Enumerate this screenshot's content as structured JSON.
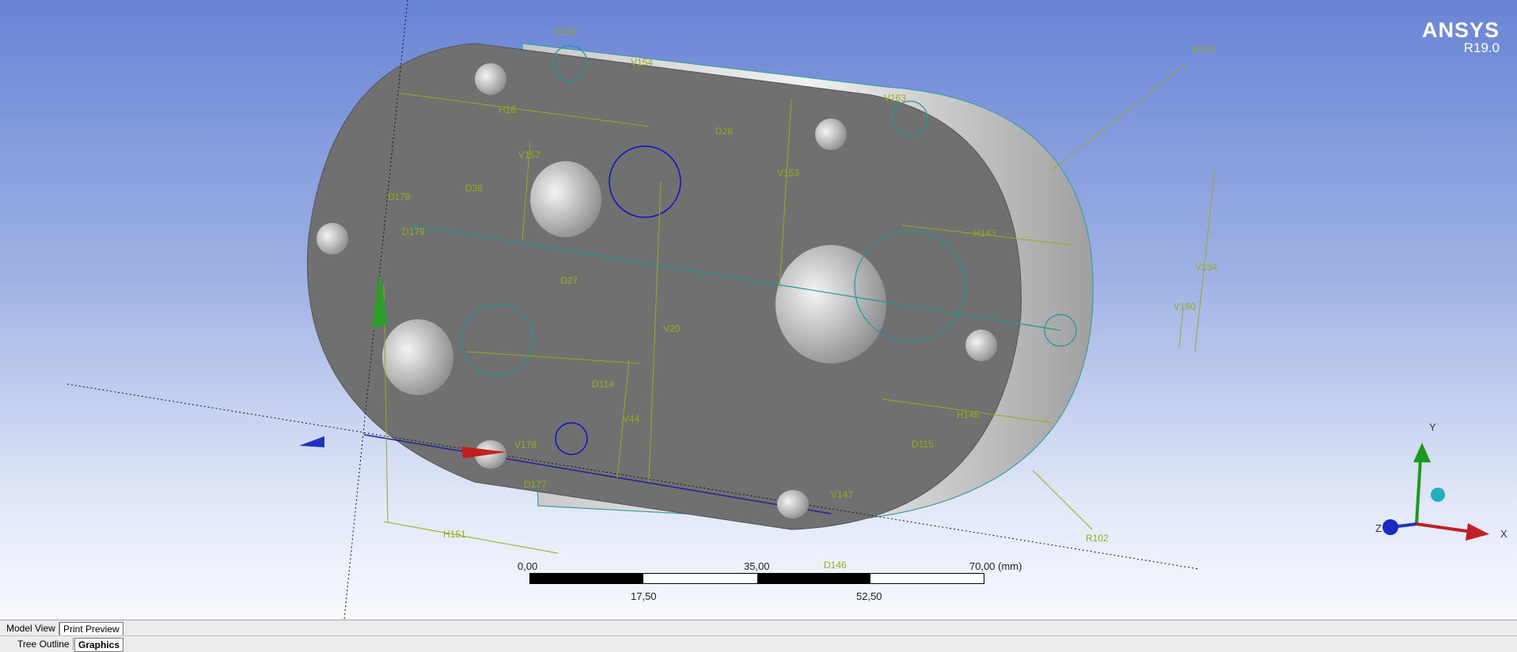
{
  "brand": {
    "name": "ANSYS",
    "version": "R19.0"
  },
  "dimensions": [
    "D152",
    "V154",
    "V163",
    "R101",
    "H16",
    "D26",
    "V157",
    "V153",
    "D178",
    "D36",
    "D179",
    "H143",
    "V134",
    "D27",
    "V160",
    "V20",
    "D114",
    "V44",
    "H145",
    "V178",
    "D115",
    "D177",
    "V147",
    "H151",
    "D146",
    "R102"
  ],
  "scale": {
    "labels_top": [
      "0,00",
      "35,00",
      "70,00 (mm)"
    ],
    "labels_bottom": [
      "17,50",
      "52,50"
    ]
  },
  "triad": {
    "x": "X",
    "y": "Y",
    "z": "Z"
  },
  "tabs_row1": [
    {
      "label": "Model View",
      "active": false
    },
    {
      "label": "Print Preview",
      "active": true
    }
  ],
  "tabs_row2": [
    {
      "label": "Tree Outline",
      "active": false
    },
    {
      "label": "Graphics",
      "active": true
    }
  ],
  "colors": {
    "part": "#6e6e6e",
    "dimension": "#9aaa1a",
    "sketch": "#1a9a9a",
    "selection": "#1010c8"
  }
}
